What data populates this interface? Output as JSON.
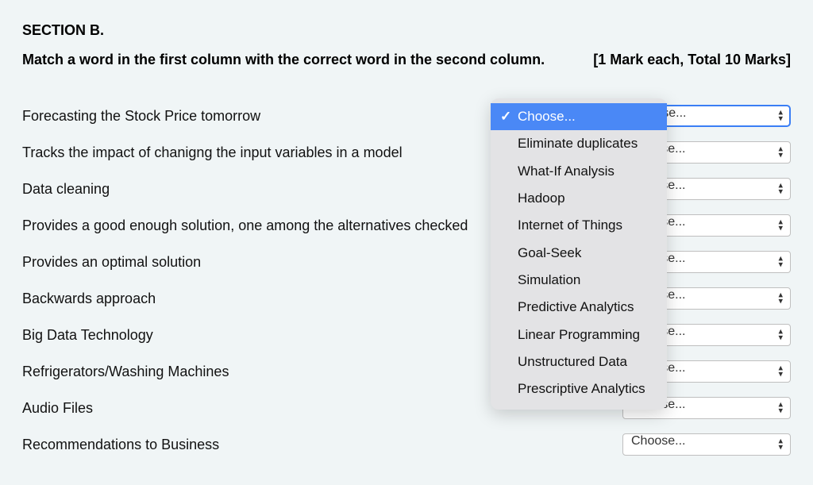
{
  "section_title": "SECTION B.",
  "instruction": "Match a word in the first column with the correct word in the second column.",
  "marks": "[1 Mark each, Total 10 Marks]",
  "placeholder": "Choose...",
  "rows": [
    {
      "label": "Forecasting the Stock Price tomorrow"
    },
    {
      "label": "Tracks the impact of chanigng the input variables in a model"
    },
    {
      "label": "Data cleaning"
    },
    {
      "label": "Provides a good enough solution, one among the alternatives checked"
    },
    {
      "label": "Provides an optimal solution"
    },
    {
      "label": "Backwards approach"
    },
    {
      "label": "Big Data Technology"
    },
    {
      "label": "Refrigerators/Washing Machines"
    },
    {
      "label": "Audio Files"
    },
    {
      "label": "Recommendations to Business"
    }
  ],
  "dropdown_options": [
    "Choose...",
    "Eliminate duplicates",
    "What-If Analysis",
    "Hadoop",
    "Internet of Things",
    "Goal-Seek",
    "Simulation",
    "Predictive Analytics",
    "Linear Programming",
    "Unstructured Data",
    "Prescriptive Analytics"
  ],
  "dropdown_selected_index": 0
}
